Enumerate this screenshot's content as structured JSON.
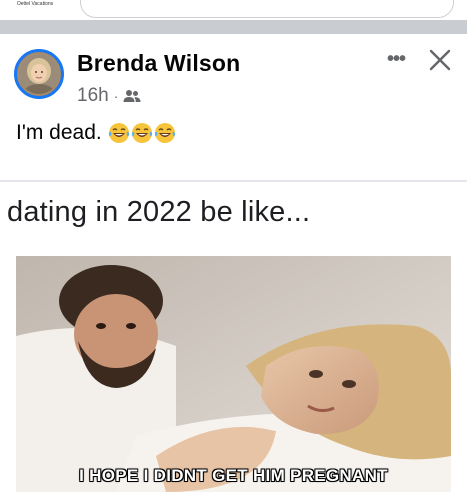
{
  "prev_post": {
    "logo_text": "Oettel Vacations"
  },
  "post": {
    "author": "Brenda Wilson",
    "time": "16h",
    "separator": "·",
    "audience_icon": "friends-icon",
    "more_icon": "more-dots-icon",
    "close_icon": "close-icon",
    "caption": "I'm dead.",
    "emojis": [
      "😂",
      "😂",
      "😂"
    ]
  },
  "meme": {
    "top_text": "dating in 2022 be like...",
    "image_caption": "I HOPE I DIDNT GET HIM PREGNANT"
  },
  "colors": {
    "avatar_ring": "#1877f2",
    "secondary_text": "#65676b",
    "divider": "#c9ccd1"
  }
}
